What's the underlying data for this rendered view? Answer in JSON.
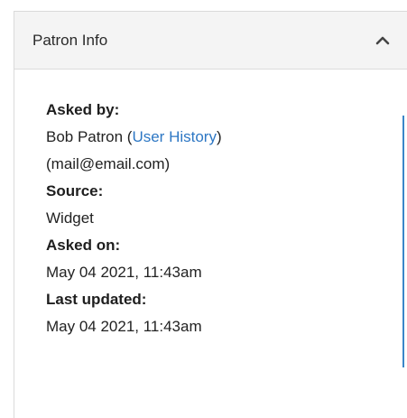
{
  "panel": {
    "title": "Patron Info",
    "toggle_icon": "chevron-up-icon"
  },
  "asked_by": {
    "label": "Asked by:",
    "name": "Bob Patron",
    "open_paren": " (",
    "link_text": "User History",
    "close_paren": ")",
    "email": "(mail@email.com)"
  },
  "source": {
    "label": "Source:",
    "value": "Widget"
  },
  "asked_on": {
    "label": "Asked on:",
    "value": "May 04 2021, 11:43am"
  },
  "last_updated": {
    "label": "Last updated:",
    "value": "May 04 2021, 11:43am"
  },
  "colors": {
    "link": "#2d77c4",
    "accent_rule": "#3b86c9",
    "header_bg": "#f4f4f4"
  }
}
